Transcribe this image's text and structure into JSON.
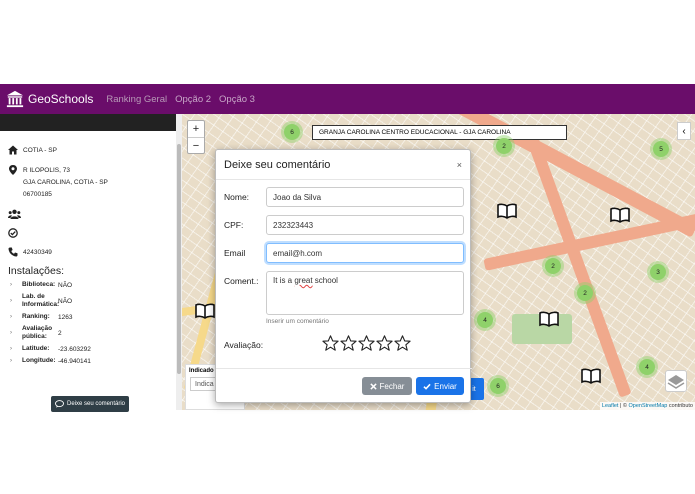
{
  "navbar": {
    "brand": "GeoSchools",
    "links": [
      "Ranking Geral",
      "Opção 2",
      "Opção 3"
    ]
  },
  "sidebar": {
    "city": "COTIA - SP",
    "address": [
      "R ILOPOLIS, 73",
      "GJA CAROLINA, COTIA - SP",
      "06700185"
    ],
    "phone": "42430349",
    "section_title": "Instalações:",
    "properties": [
      {
        "key": "Biblioteca:",
        "value": "NÃO"
      },
      {
        "key": "Lab. de Informática:",
        "value": "NÃO"
      },
      {
        "key": "Ranking:",
        "value": "1263"
      },
      {
        "key": "Avaliação pública:",
        "value": "2"
      },
      {
        "key": "Latitude:",
        "value": "-23.603292"
      },
      {
        "key": "Longitude:",
        "value": "-46.940141"
      }
    ],
    "comment_button": "Deixe seu comentário"
  },
  "map": {
    "zoom_in": "+",
    "zoom_out": "−",
    "school_label": "GRANJA CAROLINA CENTRO EDUCACIONAL - GJA CAROLINA",
    "clusters": [
      "6",
      "2",
      "5",
      "2",
      "3",
      "2",
      "4",
      "4",
      "6"
    ],
    "attribution_leaflet": "Leaflet",
    "attribution_sep": " | © ",
    "attribution_osm": "OpenStreetMap",
    "attribution_tail": " contributo",
    "under_title": "Indicado",
    "under_input": "Indica",
    "under_submit": "it",
    "panel_toggle": "‹"
  },
  "modal": {
    "title": "Deixe seu comentário",
    "close": "×",
    "fields": {
      "name_label": "Nome:",
      "name_value": "Joao da Silva",
      "cpf_label": "CPF:",
      "cpf_value": "232323443",
      "email_label": "Email",
      "email_value": "email@h.com",
      "comment_label": "Coment.:",
      "comment_value_pre": "It is a ",
      "comment_value_squiggle": "great",
      "comment_value_post": " school",
      "hint": "Inserir um comentário",
      "rating_label": "Avaliação:",
      "rating_value": 0,
      "rating_max": 5
    },
    "footer": {
      "close_label": "Fechar",
      "send_label": "Enviar"
    }
  },
  "colors": {
    "navbar": "#6a0d6a",
    "primary": "#1a73e8",
    "secondary": "#868e96",
    "cluster": "#8fd16a"
  }
}
